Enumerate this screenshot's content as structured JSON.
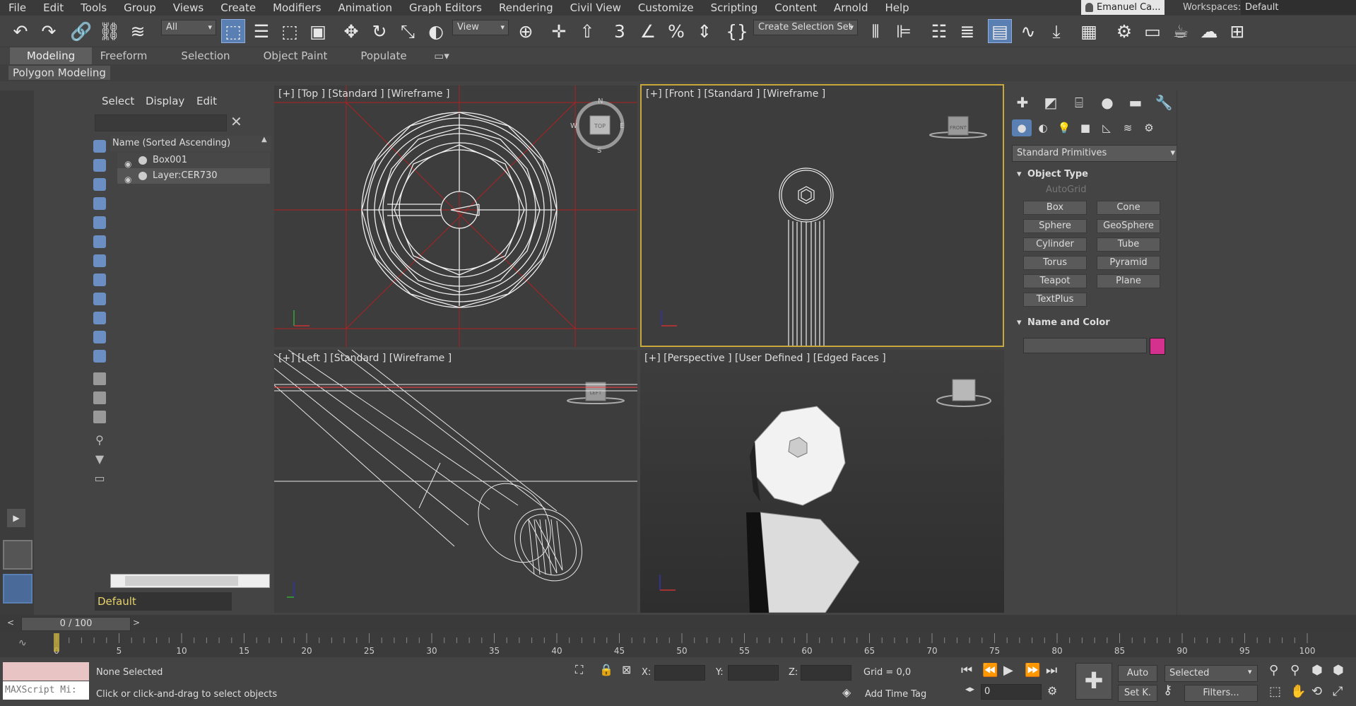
{
  "menu": [
    "File",
    "Edit",
    "Tools",
    "Group",
    "Views",
    "Create",
    "Modifiers",
    "Animation",
    "Graph Editors",
    "Rendering",
    "Civil View",
    "Customize",
    "Scripting",
    "Content",
    "Arnold",
    "Help"
  ],
  "user": {
    "name": "Emanuel Ca..."
  },
  "workspace": {
    "label": "Workspaces:",
    "value": "Default"
  },
  "toolbar": {
    "filter_value": "All",
    "refcoord_value": "View",
    "selection_set_value": "Create Selection Set"
  },
  "ribbon": {
    "tabs": [
      "Modeling",
      "Freeform",
      "Selection",
      "Object Paint",
      "Populate"
    ],
    "active_tab": "Modeling",
    "panel_label": "Polygon Modeling"
  },
  "scene_explorer": {
    "tabs": [
      "Select",
      "Display",
      "Edit"
    ],
    "column_header": "Name (Sorted Ascending)",
    "rows": [
      "Box001",
      "Layer:CER730"
    ],
    "layer_value": "Default"
  },
  "viewports": {
    "top": "[+] [Top ] [Standard ] [Wireframe ]",
    "front": "[+] [Front ] [Standard ] [Wireframe ]",
    "left": "[+] [Left ] [Standard ] [Wireframe ]",
    "perspective": "[+] [Perspective ] [User Defined ] [Edged Faces ]",
    "viewcube": {
      "top": "TOP",
      "front": "FRONT",
      "left": "LEFT",
      "compass": [
        "N",
        "E",
        "S",
        "W"
      ]
    }
  },
  "command_panel": {
    "category_value": "Standard Primitives",
    "object_type_title": "Object Type",
    "autogrid_label": "AutoGrid",
    "buttons": [
      "Box",
      "Cone",
      "Sphere",
      "GeoSphere",
      "Cylinder",
      "Tube",
      "Torus",
      "Pyramid",
      "Teapot",
      "Plane",
      "TextPlus"
    ],
    "name_color_title": "Name and Color",
    "object_color": "#d4318e"
  },
  "timeline": {
    "frame_display": "0 / 100",
    "ticks": [
      "0",
      "5",
      "10",
      "15",
      "20",
      "25",
      "30",
      "35",
      "40",
      "45",
      "50",
      "55",
      "60",
      "65",
      "70",
      "75",
      "80",
      "85",
      "90",
      "95",
      "100"
    ]
  },
  "status": {
    "maxscript_placeholder": "MAXScript Mi:",
    "selection_status": "None Selected",
    "prompt": "Click or click-and-drag to select objects",
    "x_label": "X:",
    "y_label": "Y:",
    "z_label": "Z:",
    "grid": "Grid = 0,0",
    "add_time_tag": "Add Time Tag",
    "frame_field": "0",
    "auto_key": "Auto",
    "set_key": "Set K.",
    "key_filter_value": "Selected",
    "filters": "Filters..."
  }
}
